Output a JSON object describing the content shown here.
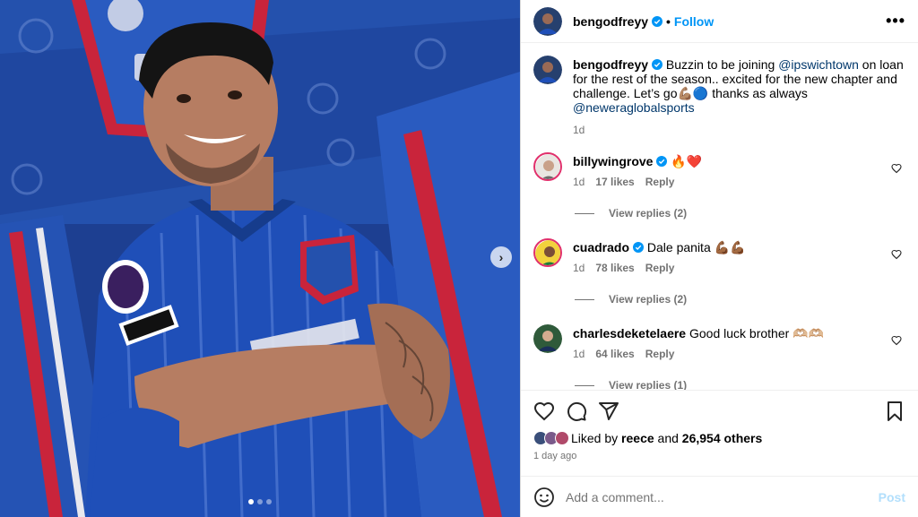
{
  "post": {
    "author": "bengodfreyy",
    "follow_label": "Follow",
    "separator": "•",
    "more_label": "•••",
    "caption_prefix": " Buzzin to be joining ",
    "caption_mention1": "@ipswichtown",
    "caption_middle": " on loan for the rest of the season.. excited for the new chapter and challenge. Let’s go💪🏽🔵 thanks as always ",
    "caption_mention2": "@neweraglobalsports",
    "caption_time": "1d"
  },
  "comments": [
    {
      "username": "billywingrove",
      "verified": true,
      "text": "🔥❤️",
      "time": "1d",
      "likes": "17 likes",
      "reply_label": "Reply",
      "view_replies": "View replies (2)"
    },
    {
      "username": "cuadrado",
      "verified": true,
      "text": "Dale panita 💪🏾💪🏾",
      "time": "1d",
      "likes": "78 likes",
      "reply_label": "Reply",
      "view_replies": "View replies (2)"
    },
    {
      "username": "charlesdeketelaere",
      "verified": false,
      "text": "Good luck brother 🫶🏼🫶🏼",
      "time": "1d",
      "likes": "64 likes",
      "reply_label": "Reply",
      "view_replies": "View replies (1)"
    }
  ],
  "likes": {
    "prefix": "Liked by ",
    "user": "reece",
    "middle": " and ",
    "count": "26,954 others",
    "time_ago": "1 day ago"
  },
  "add_comment": {
    "placeholder": "Add a comment...",
    "post_label": "Post"
  },
  "media": {
    "next_label": "›",
    "carousel_total": 3,
    "carousel_active": 0
  },
  "colors": {
    "link_blue": "#0095f6",
    "mention": "#00376b",
    "secondary": "#737373",
    "post_disabled": "#b2dffc",
    "verified": "#0095f6",
    "heart_red": "#ed4956"
  }
}
